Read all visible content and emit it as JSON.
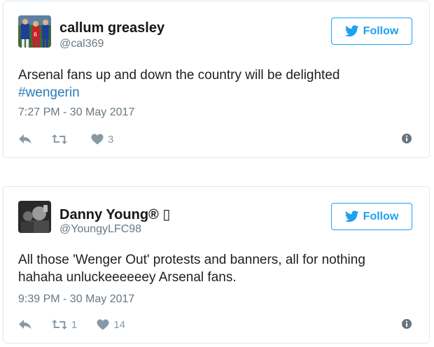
{
  "tweets": [
    {
      "name": "callum greasley",
      "handle": "@cal369",
      "follow_label": "Follow",
      "text": "Arsenal fans up and down the country will be delighted",
      "hashtag": "#wengerin",
      "timestamp": "7:27 PM - 30 May 2017",
      "retweets": "",
      "likes": "3",
      "avatar_icon": "football-players-avatar"
    },
    {
      "name": "Danny Young® ▯",
      "handle": "@YoungyLFC98",
      "follow_label": "Follow",
      "text_line1": "All those 'Wenger Out' protests and banners, all for nothing",
      "text_line2": "hahaha unluckeeeeeey Arsenal fans.",
      "timestamp": "9:39 PM - 30 May 2017",
      "retweets": "1",
      "likes": "14",
      "avatar_icon": "bw-portrait-avatar"
    }
  ],
  "colors": {
    "twitter_blue": "#1da1f2",
    "hashtag": "#2b7bb9",
    "muted": "#8899a6",
    "border": "#e1e8ed"
  }
}
